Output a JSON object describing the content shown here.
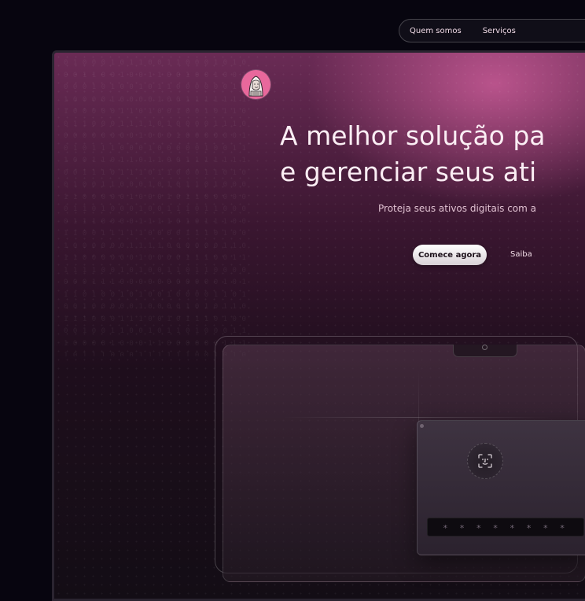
{
  "nav": {
    "items": [
      {
        "label": "Quem somos"
      },
      {
        "label": "Serviços"
      }
    ]
  },
  "hero": {
    "headline_line1": "A melhor solução pa",
    "headline_line2": "e gerenciar seus ati",
    "subtitle": "Proteja seus ativos digitais com a",
    "cta_primary": "Comece agora",
    "cta_secondary": "Saiba"
  },
  "device": {
    "password_mask": "* * * * * * * *"
  },
  "icons": {
    "logo": "hooded-figure-avatar-icon",
    "faceid": "face-id-icon"
  },
  "colors": {
    "background": "#07050f",
    "accent": "#e8689c",
    "hero_glow": "#d662a0",
    "text": "#fbeef4"
  }
}
